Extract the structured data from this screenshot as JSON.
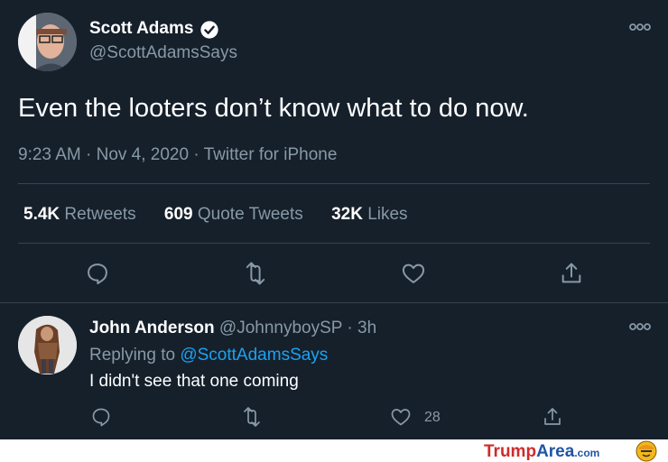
{
  "tweet": {
    "name": "Scott Adams",
    "handle": "@ScottAdamsSays",
    "text": "Even the looters don’t know what to do now.",
    "meta": "9:23 AM · Nov 4, 2020 · Twitter for iPhone",
    "stats": {
      "retweets_num": "5.4K",
      "retweets_label": "Retweets",
      "quotes_num": "609",
      "quotes_label": "Quote Tweets",
      "likes_num": "32K",
      "likes_label": "Likes"
    }
  },
  "reply": {
    "name": "John Anderson",
    "handle": "@JohnnyboySP · 3h",
    "replying_prefix": "Replying to ",
    "replying_to": "@ScottAdamsSays",
    "text": "I didn't see that one coming",
    "like_count": "28"
  },
  "watermark": {
    "part1": "Trump",
    "part2": "Area",
    "part3": ".com"
  },
  "icons": [
    "verified-badge-icon",
    "more-icon",
    "reply-icon",
    "retweet-icon",
    "like-icon",
    "share-icon"
  ],
  "colors": {
    "background": "#15202b",
    "secondary_text": "#8899a6",
    "link": "#1da1f2",
    "divider": "#38444d"
  }
}
